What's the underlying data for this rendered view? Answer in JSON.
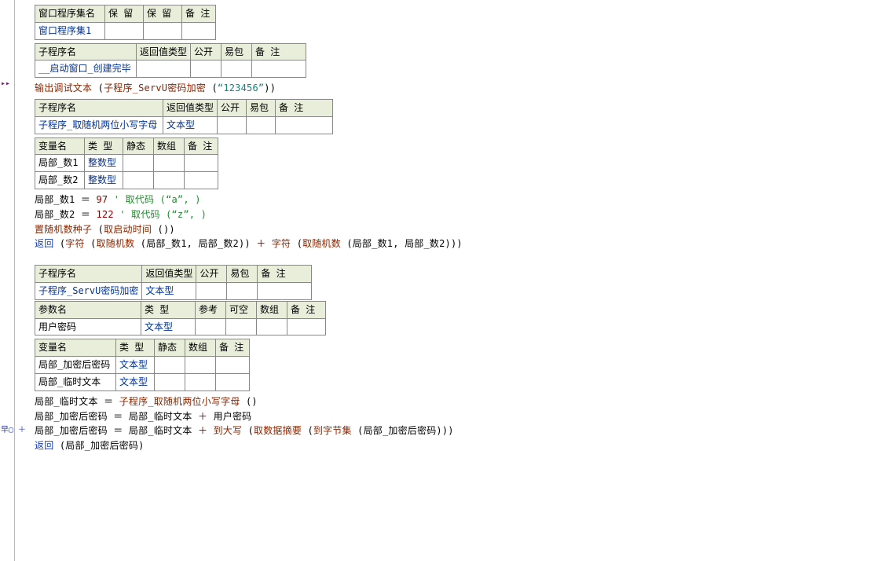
{
  "gutter": {
    "tri": "▸▸",
    "plus": "早▢ ＋"
  },
  "t1": {
    "headers": [
      "窗口程序集名",
      "保 留",
      "保 留",
      "备 注"
    ],
    "row": [
      "窗口程序集1",
      "",
      "",
      ""
    ]
  },
  "t2": {
    "headers": [
      "子程序名",
      "返回值类型",
      "公开",
      "易包",
      "备 注"
    ],
    "row": [
      "__启动窗口_创建完毕",
      "",
      "",
      "",
      ""
    ]
  },
  "line1": {
    "a": "输出调试文本 ",
    "b": "(",
    "c": "子程序_ServU密码加密 ",
    "d": "(",
    "e": "“123456”",
    "f": ")",
    "g": ")"
  },
  "t3": {
    "headers": [
      "子程序名",
      "返回值类型",
      "公开",
      "易包",
      "备 注"
    ],
    "row": [
      "子程序_取随机两位小写字母",
      "文本型",
      "",
      "",
      ""
    ]
  },
  "t4": {
    "headers": [
      "变量名",
      "类 型",
      "静态",
      "数组",
      "备 注"
    ],
    "rows": [
      [
        "局部_数1",
        "整数型",
        "",
        "",
        ""
      ],
      [
        "局部_数2",
        "整数型",
        "",
        "",
        ""
      ]
    ]
  },
  "linesA": {
    "l1": {
      "a": "局部_数1 ",
      "b": "＝ ",
      "c": "97  ",
      "d": "' 取代码 (“a”, )"
    },
    "l2": {
      "a": "局部_数2 ",
      "b": "＝ ",
      "c": "122  ",
      "d": "' 取代码 (“z”, )"
    },
    "l3": {
      "a": "置随机数种子 ",
      "b": "(",
      "c": "取启动时间 ",
      "d": "()",
      "e": ")"
    },
    "l4": {
      "a": "返回 ",
      "b": "(",
      "c": "字符 ",
      "d": "(",
      "e": "取随机数 ",
      "f": "(局部_数1, 局部_数2)",
      "g": ") ",
      "h": "＋ ",
      "i": "字符 ",
      "j": "(",
      "k": "取随机数 ",
      "l": "(局部_数1, 局部_数2)",
      "m": ")",
      "n": ")"
    }
  },
  "t5": {
    "headers": [
      "子程序名",
      "返回值类型",
      "公开",
      "易包",
      "备 注"
    ],
    "row": [
      "子程序_ServU密码加密",
      "文本型",
      "",
      "",
      ""
    ]
  },
  "t6": {
    "headers": [
      "参数名",
      "类 型",
      "参考",
      "可空",
      "数组",
      "备 注"
    ],
    "row": [
      "用户密码",
      "文本型",
      "",
      "",
      "",
      ""
    ]
  },
  "t7": {
    "headers": [
      "变量名",
      "类 型",
      "静态",
      "数组",
      "备 注"
    ],
    "rows": [
      [
        "局部_加密后密码",
        "文本型",
        "",
        "",
        ""
      ],
      [
        "局部_临时文本",
        "文本型",
        "",
        "",
        ""
      ]
    ]
  },
  "linesB": {
    "l1": {
      "a": "局部_临时文本 ",
      "b": "＝ ",
      "c": " 子程序_取随机两位小写字母 ",
      "d": "()"
    },
    "l2": {
      "a": "局部_加密后密码 ",
      "b": "＝ ",
      "c": " 局部_临时文本 ",
      "d": "＋ ",
      "e": " 用户密码"
    },
    "l3": {
      "a": "局部_加密后密码 ",
      "b": "＝ ",
      "c": " 局部_临时文本 ",
      "d": "＋ ",
      "e": "到大写 ",
      "f": "(",
      "g": "取数据摘要 ",
      "h": "(",
      "i": "到字节集 ",
      "j": "(局部_加密后密码)",
      "k": ")",
      "l": ")"
    },
    "l4": {
      "a": "返回 ",
      "b": "(局部_加密后密码)"
    }
  }
}
